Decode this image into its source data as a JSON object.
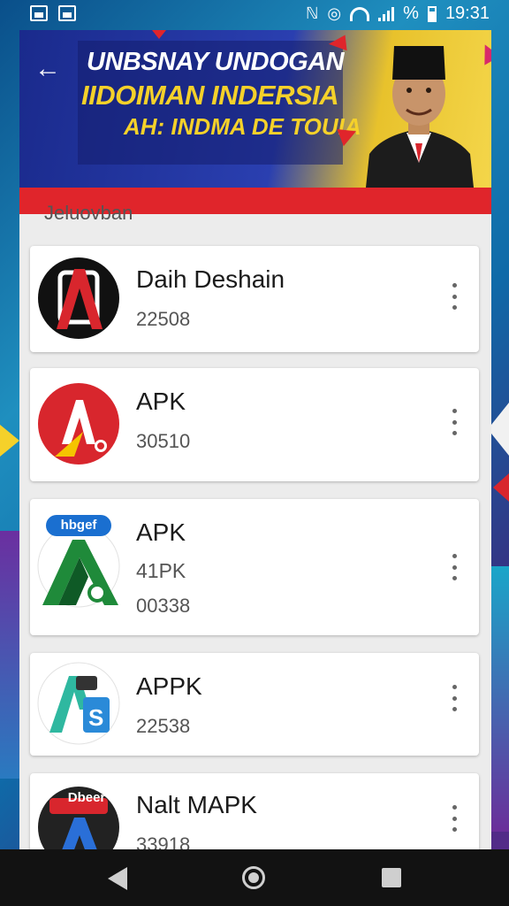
{
  "status_bar": {
    "time": "19:31",
    "battery_label": "%",
    "icons": [
      "image-icon",
      "image-icon",
      "nfc-icon",
      "data-saver-icon",
      "wifi-icon",
      "signal-icon",
      "battery-icon"
    ]
  },
  "banner": {
    "line1": "UNBSNAY UNDOGAN",
    "line2": "IIDOIMAN INDERSIA",
    "line3": "AH: INDMA DE TOUIA",
    "back_icon": "arrow-left-icon"
  },
  "section_label": "Jeluovban",
  "apps": [
    {
      "title": "Daih Deshain",
      "subtitles": [
        "22508"
      ]
    },
    {
      "title": "APK",
      "subtitles": [
        "30510"
      ]
    },
    {
      "title": "APK",
      "icon_badge": "hbgef",
      "subtitles": [
        "41PK",
        "00338"
      ]
    },
    {
      "title": "APPK",
      "subtitles": [
        "22538"
      ]
    },
    {
      "title": "Nalt MAPK",
      "icon_badge": "Dbeer",
      "subtitles": [
        "33918"
      ]
    }
  ],
  "colors": {
    "banner_red": "#e0252b",
    "banner_yellow": "#f5d12a",
    "banner_blue": "#1a2a8c",
    "nav_bar": "#121212"
  }
}
